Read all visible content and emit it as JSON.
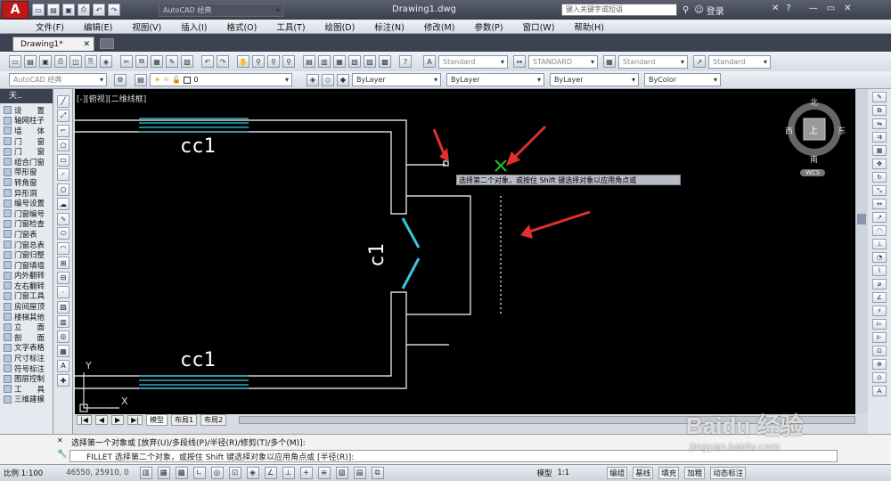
{
  "titlebar": {
    "app_logo": "A",
    "workspace": "AutoCAD 经典",
    "doc_title": "Drawing1.dwg",
    "search_placeholder": "键入关键字或短语",
    "login": "登录",
    "quick_icons": [
      "new-icon",
      "open-icon",
      "save-icon",
      "print-icon",
      "undo-icon",
      "redo-icon"
    ]
  },
  "menu": [
    "文件(F)",
    "编辑(E)",
    "视图(V)",
    "插入(I)",
    "格式(O)",
    "工具(T)",
    "绘图(D)",
    "标注(N)",
    "修改(M)",
    "参数(P)",
    "窗口(W)",
    "帮助(H)"
  ],
  "doc_tab": "Drawing1*",
  "toolbar_styles": {
    "text_style": "Standard",
    "dim_style": "STANDARD",
    "table_style": "Standard",
    "mleader_style": "Standard"
  },
  "toolbar_layers": {
    "workspace": "AutoCAD 经典",
    "layer_value": "0",
    "color": "ByLayer",
    "linetype": "ByLayer",
    "lineweight": "ByLayer",
    "plotstyle": "ByColor"
  },
  "left_panel": {
    "header": "天..",
    "items": [
      "设　　置",
      "轴网柱子",
      "墙　　体",
      "门　　窗",
      "门　　窗",
      "组合门窗",
      "带形窗",
      "转角窗",
      "异形洞",
      "编号设置",
      "门窗编号",
      "门窗检查",
      "门窗表",
      "门窗总表",
      "门窗归整",
      "门窗填墙",
      "内外翻转",
      "左右翻转",
      "门窗工具",
      "房间屋顶",
      "楼梯其他",
      "立　　面",
      "剖　　面",
      "文字表格",
      "尺寸标注",
      "符号标注",
      "图层控制",
      "工　　具",
      "三维建模"
    ]
  },
  "canvas": {
    "view_label": "[-][俯视][二维线框]",
    "tooltip": "选择第二个对象，或按住 Shift 键选择对象以应用角点或",
    "label_top": "cc1",
    "label_bottom": "cc1",
    "label_right": "c1",
    "cube": {
      "north": "北",
      "south": "南",
      "east": "东",
      "west": "西",
      "top": "上",
      "wcs": "WCS"
    },
    "ucs_x": "X",
    "ucs_y": "Y"
  },
  "layout_tabs": [
    "模型",
    "布局1",
    "布局2"
  ],
  "command": {
    "history": "选择第一个对象或 [放弃(U)/多段线(P)/半径(R)/修剪(T)/多个(M)]:",
    "prompt": "FILLET 选择第二个对象，或按住 Shift 键选择对象以应用角点或 [半径(R)]:"
  },
  "status": {
    "scale": "比例 1:100",
    "coords": "46550, 25910, 0",
    "model": "模型",
    "anno_scale": "1:1",
    "buttons": [
      "编组",
      "基线",
      "填充",
      "加粗",
      "动态标注"
    ]
  },
  "watermark": {
    "brand": "Baidu 经验",
    "url": "jingyan.baidu.com"
  },
  "colors": {
    "accent": "#e03030",
    "cad_bg": "#000000",
    "cad_line": "#ffffff",
    "window_cyan": "#38c8dc",
    "cross_green": "#19c019"
  }
}
